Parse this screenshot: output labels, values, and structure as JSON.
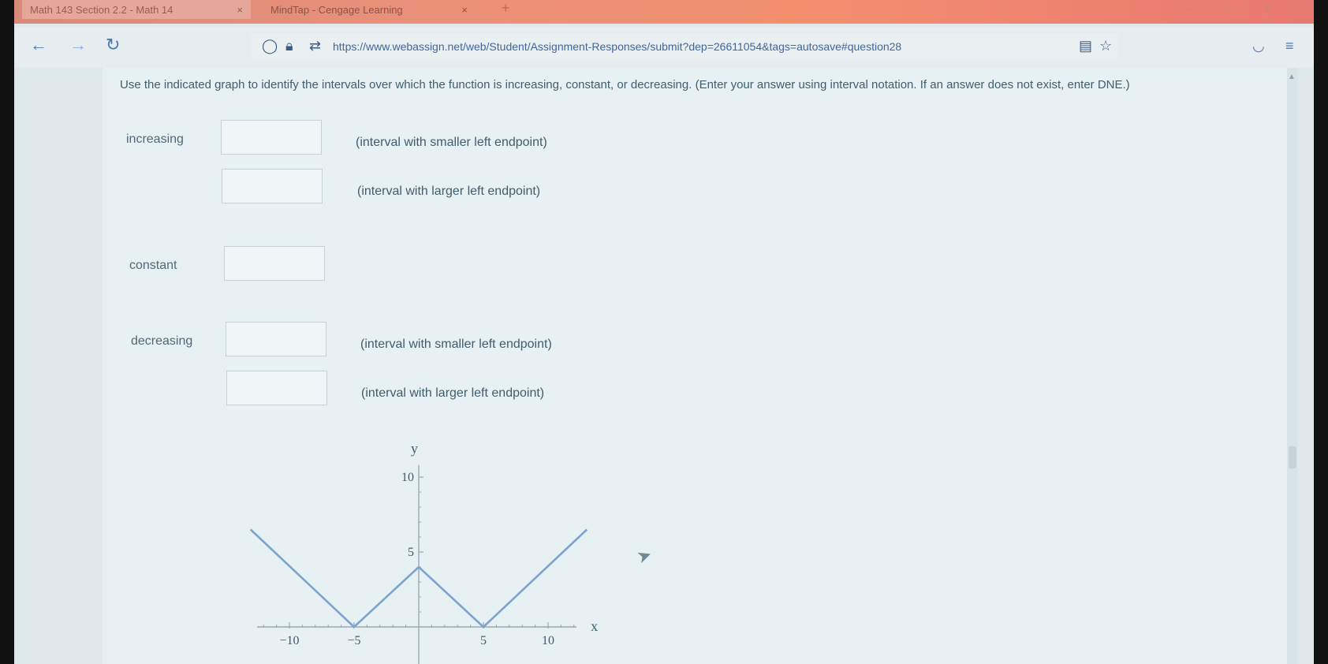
{
  "browser": {
    "tabs": [
      {
        "label": "Math 143 Section 2.2 - Math 14",
        "close": "×"
      },
      {
        "label": "MindTap - Cengage Learning",
        "close": "×"
      }
    ],
    "new_tab": "+",
    "url": "https://www.webassign.net/web/Student/Assignment-Responses/submit?dep=26611054&tags=autosave#question28"
  },
  "question": {
    "prompt": "Use the indicated graph to identify the intervals over which the function is increasing, constant, or decreasing. (Enter your answer using interval notation. If an answer does not exist, enter DNE.)"
  },
  "answers": {
    "increasing_label": "increasing",
    "constant_label": "constant",
    "decreasing_label": "decreasing",
    "hint_smaller": "(interval with smaller left endpoint)",
    "hint_larger": "(interval with larger left endpoint)",
    "fields": [
      {
        "value": ""
      },
      {
        "value": ""
      },
      {
        "value": ""
      },
      {
        "value": ""
      },
      {
        "value": ""
      }
    ]
  },
  "chart_data": {
    "type": "line",
    "xlabel": "x",
    "ylabel": "y",
    "x_ticks": [
      -10,
      -5,
      5,
      10
    ],
    "y_ticks": [
      5,
      10
    ],
    "xlim": [
      -13,
      13
    ],
    "ylim": [
      -2,
      11
    ],
    "series": [
      {
        "x": [
          -13,
          -5,
          0,
          5,
          13
        ],
        "y": [
          6.5,
          0,
          4,
          0,
          6.5
        ],
        "color": "#7da3cf"
      }
    ],
    "grid": false
  }
}
